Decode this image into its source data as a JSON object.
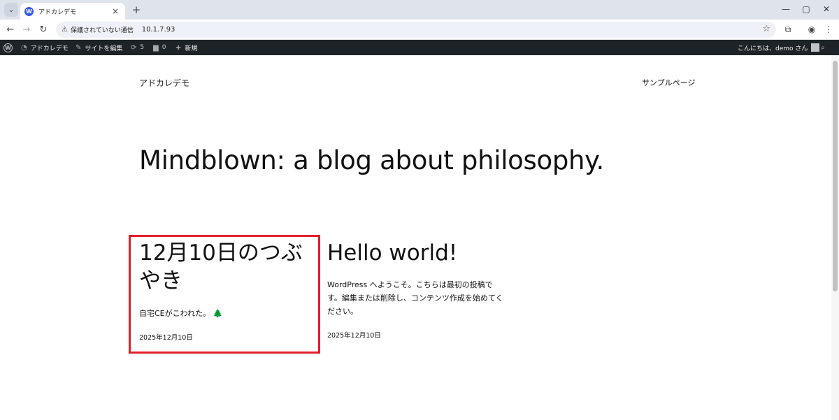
{
  "browser": {
    "tab_title": "アドカレデモ",
    "tab_favicon": "W",
    "tab_close": "×",
    "new_tab": "+",
    "minimize": "—",
    "maximize": "▢",
    "close": "✕",
    "back": "←",
    "forward": "→",
    "reload": "↻",
    "security_warning": "保護されていない通信",
    "url": "10.1.7.93"
  },
  "admin_bar": {
    "site_name": "アドカレデモ",
    "customize": "サイトを編集",
    "updates_count": "5",
    "comments_count": "0",
    "new": "新規",
    "greeting": "こんにちは、demo さん"
  },
  "site": {
    "title": "アドカレデモ",
    "nav_item": "サンプルページ",
    "tagline": "Mindblown: a blog about philosophy."
  },
  "posts": [
    {
      "title": "12月10日のつぶやき",
      "excerpt": "自宅CEがこわれた。",
      "emoji": "🌲",
      "date": "2025年12月10日"
    },
    {
      "title": "Hello world!",
      "excerpt": "WordPress へようこそ。こちらは最初の投稿です。編集または削除し、コンテンツ作成を始めてください。",
      "date": "2025年12月10日"
    }
  ],
  "colors": {
    "highlight": "#e01e2a",
    "admin_bar_bg": "#1d2327"
  }
}
